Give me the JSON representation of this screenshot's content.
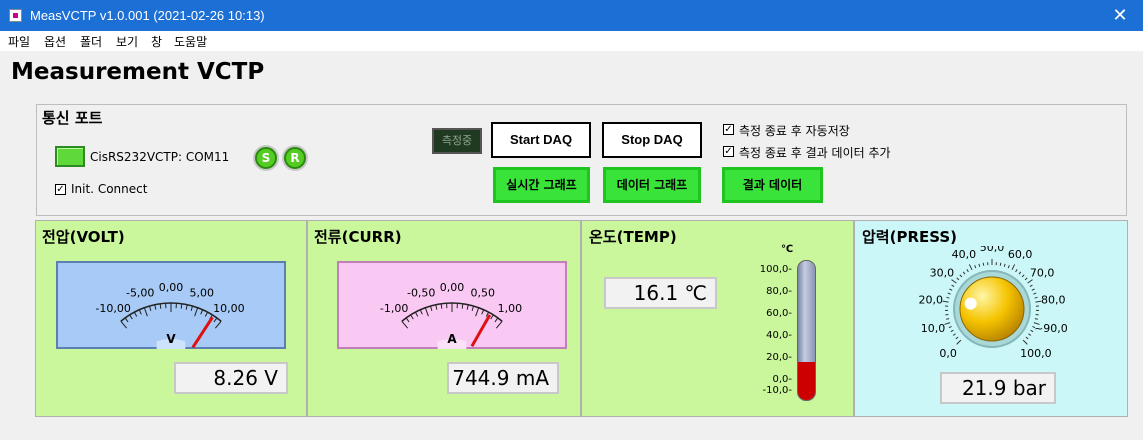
{
  "window": {
    "title": "MeasVCTP v1.0.001 (2021-02-26 10:13)",
    "close_glyph": "✕"
  },
  "menu": [
    "파일",
    "옵션",
    "폴더",
    "보기",
    "창",
    "도움말"
  ],
  "page_title": "Measurement VCTP",
  "comm": {
    "label": "통신 포트",
    "port": "CisRS232VCTP: COM11",
    "led_s": "S",
    "led_r": "R",
    "init_connect": "Init. Connect"
  },
  "daq": {
    "status": "측정중",
    "start": "Start DAQ",
    "stop": "Stop DAQ",
    "realtime": "실시간 그래프",
    "data_graph": "데이터 그래프",
    "result": "결과 데이터"
  },
  "options": {
    "autosave": "측정 종료 후 자동저장",
    "append": "측정 종료 후 결과 데이터 추가",
    "checkmark": "✓"
  },
  "volt": {
    "title": "전압(VOLT)",
    "ticks": [
      "-10,00",
      "-5,00",
      "0,00",
      "5,00",
      "10,00"
    ],
    "unit": "V",
    "value": 8.26,
    "readout": "8.26  V",
    "range": [
      -10,
      10
    ],
    "color": "#a8caf6"
  },
  "curr": {
    "title": "전류(CURR)",
    "ticks": [
      "-1,00",
      "-0,50",
      "0,00",
      "0,50",
      "1,00"
    ],
    "unit": "A",
    "value": 0.7449,
    "readout": "744.9 mA",
    "range": [
      -1,
      1
    ],
    "color": "#f9c9f4"
  },
  "temp": {
    "title": "온도(TEMP)",
    "readout": "16.1 ℃",
    "unit": "℃",
    "value": 16.1,
    "ticks": [
      "100,0-",
      "80,0-",
      "60,0-",
      "40,0-",
      "20,0-",
      "0,0-",
      "-10,0-"
    ]
  },
  "press": {
    "title": "압력(PRESS)",
    "ticks": [
      "0,0",
      "10,0",
      "20,0",
      "30,0",
      "40,0",
      "50,0",
      "60,0",
      "70,0",
      "80,0",
      "~90,0",
      "100,0"
    ],
    "value": 21.9,
    "readout": "21.9 bar"
  },
  "colors": {
    "titlebar": "#1c6fd4",
    "panel_green": "#cbf79c",
    "panel_cyan": "#ccf7f9",
    "button_green": "#39e33a"
  }
}
